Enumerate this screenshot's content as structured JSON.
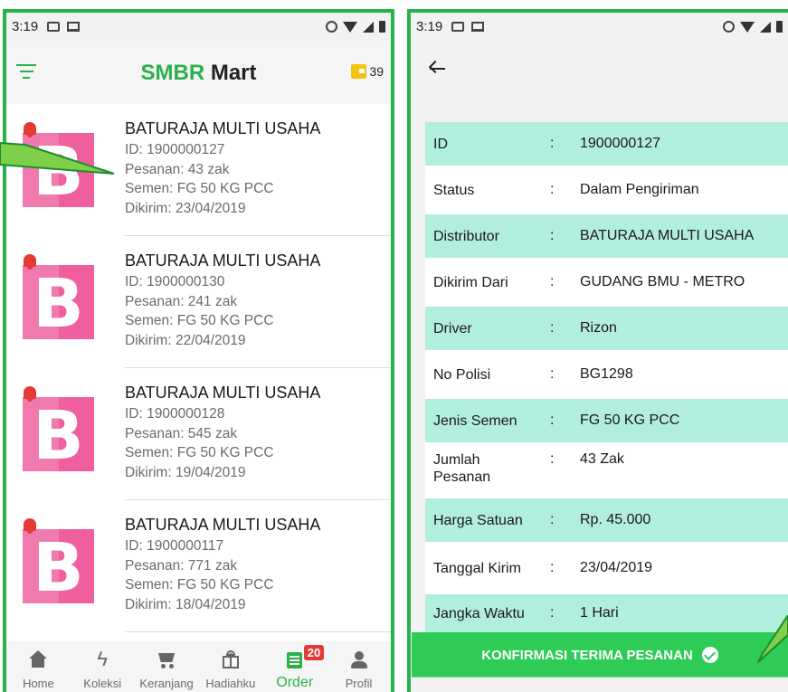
{
  "status_bar": {
    "time": "3:19"
  },
  "left_screen": {
    "app_title_brand": "SMBR",
    "app_title_rest": " Mart",
    "wallet_count": "39",
    "orders": [
      {
        "name": "BATURAJA MULTI USAHA",
        "id": "ID: 1900000127",
        "pesanan": "Pesanan: 43 zak",
        "semen": "Semen: FG 50 KG PCC",
        "dikirim": "Dikirim: 23/04/2019"
      },
      {
        "name": "BATURAJA MULTI USAHA",
        "id": "ID: 1900000130",
        "pesanan": "Pesanan: 241 zak",
        "semen": "Semen: FG 50 KG PCC",
        "dikirim": "Dikirim: 22/04/2019"
      },
      {
        "name": "BATURAJA MULTI USAHA",
        "id": "ID: 1900000128",
        "pesanan": "Pesanan: 545 zak",
        "semen": "Semen: FG 50 KG PCC",
        "dikirim": "Dikirim: 19/04/2019"
      },
      {
        "name": "BATURAJA MULTI USAHA",
        "id": "ID: 1900000117",
        "pesanan": "Pesanan: 771 zak",
        "semen": "Semen: FG 50 KG PCC",
        "dikirim": "Dikirim: 18/04/2019"
      }
    ],
    "logo_letter": "B",
    "nav": [
      {
        "label": "Home",
        "icon": "home-icon"
      },
      {
        "label": "Koleksi",
        "icon": "bolt-icon"
      },
      {
        "label": "Keranjang",
        "icon": "cart-icon"
      },
      {
        "label": "Hadiahku",
        "icon": "gift-icon"
      },
      {
        "label": "Order",
        "icon": "order-icon",
        "badge": "20"
      },
      {
        "label": "Profil",
        "icon": "profile-icon"
      }
    ]
  },
  "right_screen": {
    "details": [
      {
        "label": "ID",
        "value": "1900000127"
      },
      {
        "label": "Status",
        "value": "Dalam Pengiriman"
      },
      {
        "label": "Distributor",
        "value": "BATURAJA MULTI USAHA"
      },
      {
        "label": "Dikirim Dari",
        "value": "GUDANG BMU - METRO"
      },
      {
        "label": "Driver",
        "value": "Rizon"
      },
      {
        "label": "No Polisi",
        "value": "BG1298"
      },
      {
        "label": "Jenis Semen",
        "value": "FG 50 KG PCC"
      },
      {
        "label": "Jumlah Pesanan",
        "value": "43 Zak"
      },
      {
        "label": "Harga Satuan",
        "value": "Rp. 45.000"
      },
      {
        "label": "Tanggal Kirim",
        "value": "23/04/2019"
      },
      {
        "label": "Jangka Waktu",
        "value": "1 Hari"
      }
    ],
    "colon": ":",
    "confirm_label": "KONFIRMASI TERIMA PESANAN"
  },
  "colors": {
    "brand_green": "#2bb04a",
    "alt_row": "#b1eedd",
    "logo_pink": "#ef5f9e",
    "alert_red": "#e53935"
  }
}
